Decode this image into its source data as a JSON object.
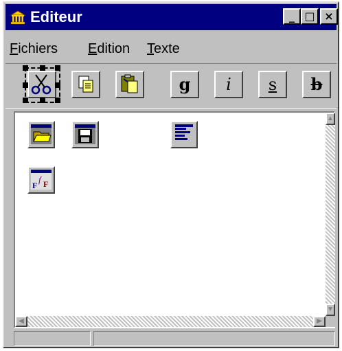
{
  "window": {
    "title": "Editeur",
    "app_icon": "building-icon"
  },
  "title_buttons": [
    {
      "name": "minimize-button",
      "label": "_"
    },
    {
      "name": "maximize-button",
      "label": "□"
    },
    {
      "name": "close-button",
      "label": "×"
    }
  ],
  "menu": {
    "items": [
      {
        "first": "F",
        "rest": "ichiers"
      },
      {
        "first": "E",
        "rest": "dition"
      },
      {
        "first": "T",
        "rest": "exte"
      }
    ]
  },
  "toolbar": {
    "tools": [
      {
        "icon": "scissors-icon",
        "selected": true
      },
      {
        "icon": "copy-icon"
      },
      {
        "icon": "paste-icon"
      },
      {
        "icon": "bold-icon",
        "glyph": "g"
      },
      {
        "icon": "italic-icon",
        "glyph": "i"
      },
      {
        "icon": "underline-icon",
        "glyph": "s"
      },
      {
        "icon": "strikethrough-icon",
        "glyph": "b"
      }
    ]
  },
  "client": {
    "icons": [
      {
        "icon": "open-folder-icon"
      },
      {
        "icon": "save-disk-icon"
      },
      {
        "icon": "align-text-icon"
      },
      {
        "icon": "font-icon",
        "text": "F f F"
      }
    ]
  },
  "colors": {
    "titlebar": "#000080",
    "face": "#c0c0c0",
    "highlight": "#ffffff",
    "shadow": "#404040"
  }
}
